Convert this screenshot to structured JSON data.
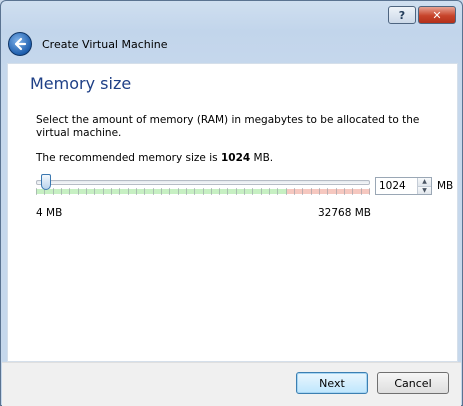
{
  "titlebar": {
    "help_label": "?",
    "close_label": "✕"
  },
  "header": {
    "back_icon": "back-arrow-icon",
    "title": "Create Virtual Machine"
  },
  "page": {
    "title": "Memory size",
    "description": "Select the amount of memory (RAM) in megabytes to be allocated to the virtual machine.",
    "recommend_prefix": "The recommended memory size is ",
    "recommend_value": "1024",
    "recommend_suffix": " MB."
  },
  "memory": {
    "value": "1024",
    "unit": "MB",
    "min_label": "4 MB",
    "max_label": "32768 MB",
    "min": 4,
    "max": 32768,
    "current": 1024,
    "green_fraction": 0.75,
    "tick_count": 41
  },
  "buttons": {
    "next": "Next",
    "cancel": "Cancel"
  }
}
